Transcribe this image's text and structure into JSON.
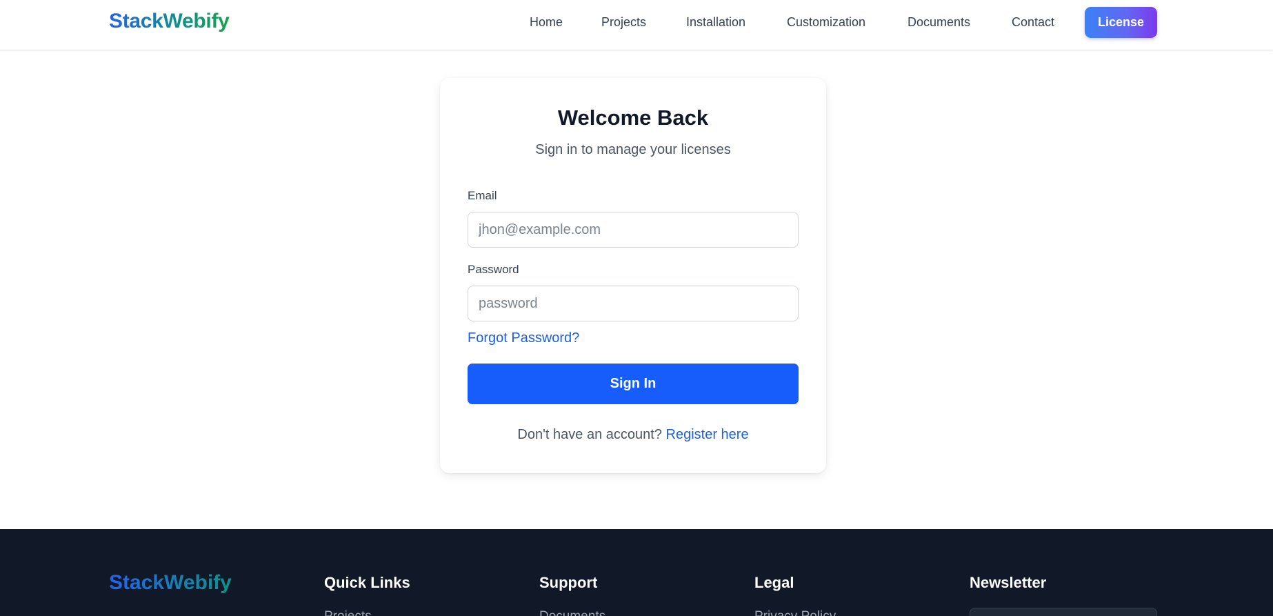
{
  "header": {
    "brand": "StackWebify",
    "nav": [
      {
        "label": "Home"
      },
      {
        "label": "Projects"
      },
      {
        "label": "Installation"
      },
      {
        "label": "Customization"
      },
      {
        "label": "Documents"
      },
      {
        "label": "Contact"
      }
    ],
    "license_label": "License"
  },
  "login": {
    "title": "Welcome Back",
    "subtitle": "Sign in to manage your licenses",
    "email_label": "Email",
    "email_placeholder": "jhon@example.com",
    "email_value": "",
    "password_label": "Password",
    "password_placeholder": "password",
    "password_value": "",
    "forgot_label": "Forgot Password?",
    "signin_label": "Sign In",
    "register_prompt": "Don't have an account?",
    "register_link": "Register here"
  },
  "footer": {
    "brand": "StackWebify",
    "columns": [
      {
        "heading": "Quick Links",
        "first_link": "Projects"
      },
      {
        "heading": "Support",
        "first_link": "Documents"
      },
      {
        "heading": "Legal",
        "first_link": "Privacy Policy"
      },
      {
        "heading": "Newsletter"
      }
    ]
  },
  "colors": {
    "primary_button": "#175dfc",
    "link": "#1d5fe0",
    "footer_bg": "#111827"
  }
}
